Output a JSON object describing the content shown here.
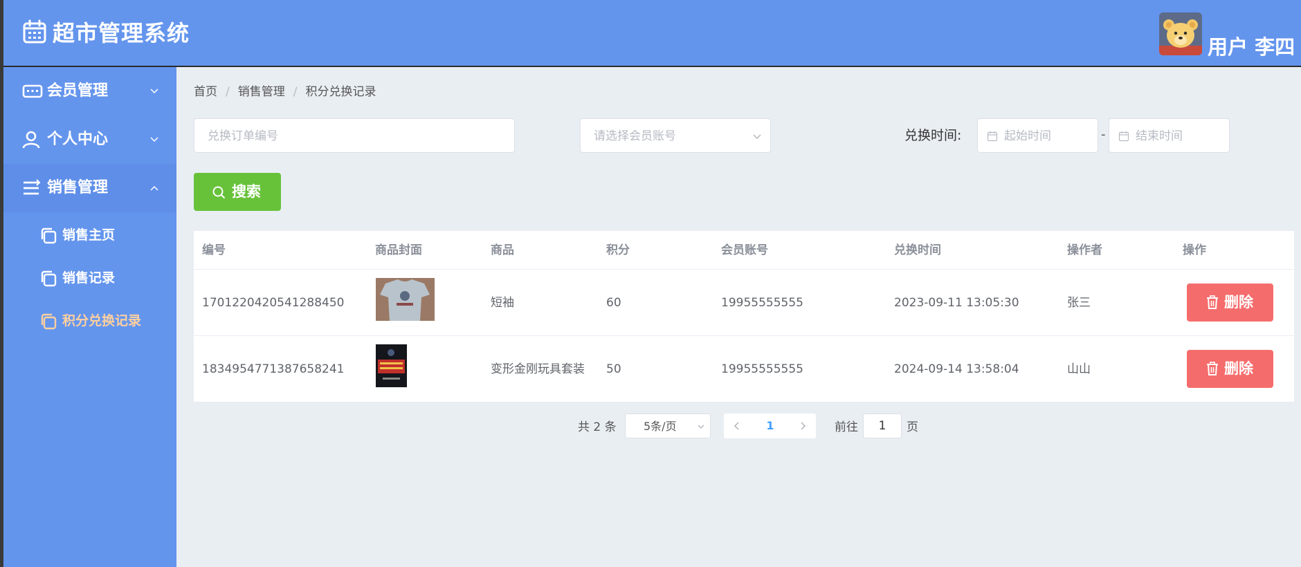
{
  "header": {
    "app_title": "超市管理系统",
    "user_label": "用户 李四"
  },
  "sidebar": {
    "groups": [
      {
        "label": "会员管理",
        "icon": "keyboard-icon",
        "expanded": false
      },
      {
        "label": "个人中心",
        "icon": "user-icon",
        "expanded": false
      },
      {
        "label": "销售管理",
        "icon": "list-icon",
        "expanded": true
      }
    ],
    "sub_items": [
      {
        "label": "销售主页",
        "icon": "copy-icon",
        "active": false
      },
      {
        "label": "销售记录",
        "icon": "copy-icon",
        "active": false
      },
      {
        "label": "积分兑换记录",
        "icon": "copy-icon",
        "active": true
      }
    ]
  },
  "breadcrumb": [
    "首页",
    "销售管理",
    "积分兑换记录"
  ],
  "filters": {
    "order_placeholder": "兑换订单编号",
    "member_placeholder": "请选择会员账号",
    "time_label": "兑换时间:",
    "start_placeholder": "起始时间",
    "dash": "-",
    "end_placeholder": "结束时间",
    "search_label": "搜索"
  },
  "table": {
    "columns": [
      "编号",
      "商品封面",
      "商品",
      "积分",
      "会员账号",
      "兑换时间",
      "操作者",
      "操作"
    ],
    "rows": [
      {
        "id": "1701220420541288450",
        "product": "短袖",
        "points": "60",
        "member": "19955555555",
        "time": "2023-09-11 13:05:30",
        "operator": "张三",
        "action": "删除"
      },
      {
        "id": "1834954771387658241",
        "product": "变形金刚玩具套装",
        "points": "50",
        "member": "19955555555",
        "time": "2024-09-14 13:58:04",
        "operator": "山山",
        "action": "删除"
      }
    ]
  },
  "pagination": {
    "total": "共 2 条",
    "page_size": "5条/页",
    "current": "1",
    "goto_prefix": "前往",
    "goto_value": "1",
    "goto_suffix": "页"
  },
  "colors": {
    "primary": "#6495ed",
    "success": "#67c23a",
    "danger": "#f56c6c",
    "active_submenu": "#fdd0a0",
    "link": "#409eff"
  }
}
